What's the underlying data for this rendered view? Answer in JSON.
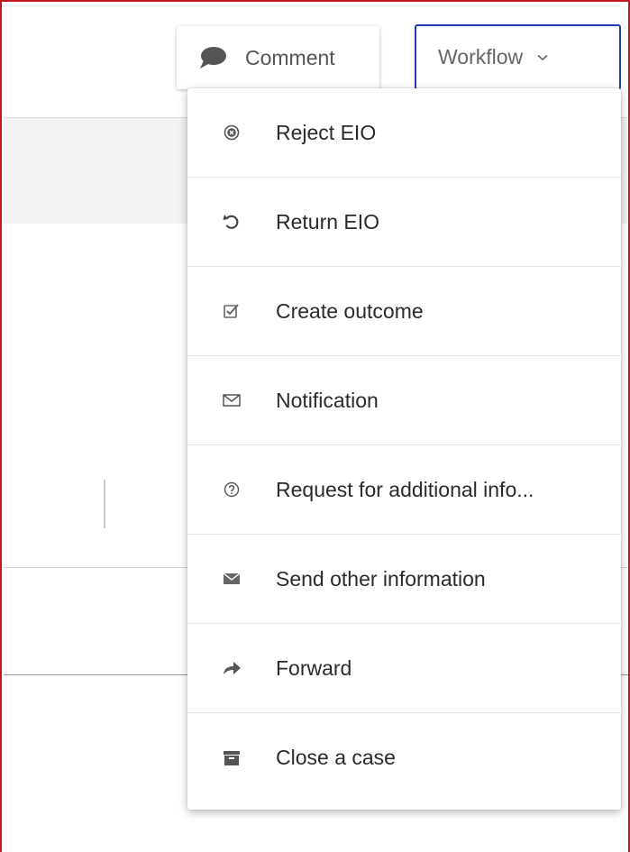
{
  "toolbar": {
    "comment_label": "Comment",
    "workflow_label": "Workflow",
    "comment_icon": "speech-bubble-icon",
    "workflow_icon": "chevron-down-icon"
  },
  "workflow_menu": {
    "items": [
      {
        "label": "Reject EIO",
        "icon": "reject-circle-icon"
      },
      {
        "label": "Return EIO",
        "icon": "return-arrow-icon"
      },
      {
        "label": "Create outcome",
        "icon": "checkbox-icon"
      },
      {
        "label": "Notification",
        "icon": "envelope-outline-icon"
      },
      {
        "label": "Request for additional info...",
        "icon": "question-circle-icon"
      },
      {
        "label": "Send other information",
        "icon": "envelope-filled-icon"
      },
      {
        "label": "Forward",
        "icon": "forward-arrow-icon"
      },
      {
        "label": "Close a case",
        "icon": "archive-box-icon"
      }
    ]
  },
  "colors": {
    "frame_border": "#c4161c",
    "workflow_focus_border": "#1c3bb5",
    "icon_gray": "#666666"
  }
}
